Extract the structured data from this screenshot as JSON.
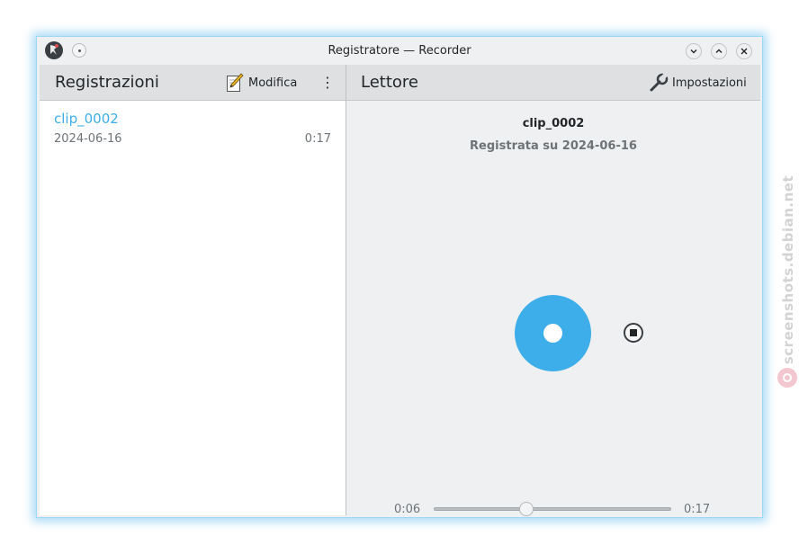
{
  "window": {
    "title": "Registratore — Recorder"
  },
  "recordings_pane": {
    "title": "Registrazioni",
    "edit_label": "Modifica",
    "items": [
      {
        "name": "clip_0002",
        "date": "2024-06-16",
        "duration": "0:17"
      }
    ]
  },
  "player_pane": {
    "title": "Lettore",
    "settings_label": "Impostazioni",
    "clip_title": "clip_0002",
    "clip_subtitle": "Registrata su 2024-06-16",
    "current_time": "0:06",
    "total_time": "0:17",
    "progress_fraction": 0.39
  },
  "watermark": {
    "text": "screenshots.debian.net"
  },
  "colors": {
    "accent": "#3daee9",
    "window_glow": "#9cd8f4"
  },
  "icons": {
    "app": "recorder-app-icon",
    "edit": "pencil-icon",
    "menu": "kebab-menu-icon",
    "settings": "wrench-icon",
    "play": "play-icon",
    "stop": "stop-icon"
  }
}
